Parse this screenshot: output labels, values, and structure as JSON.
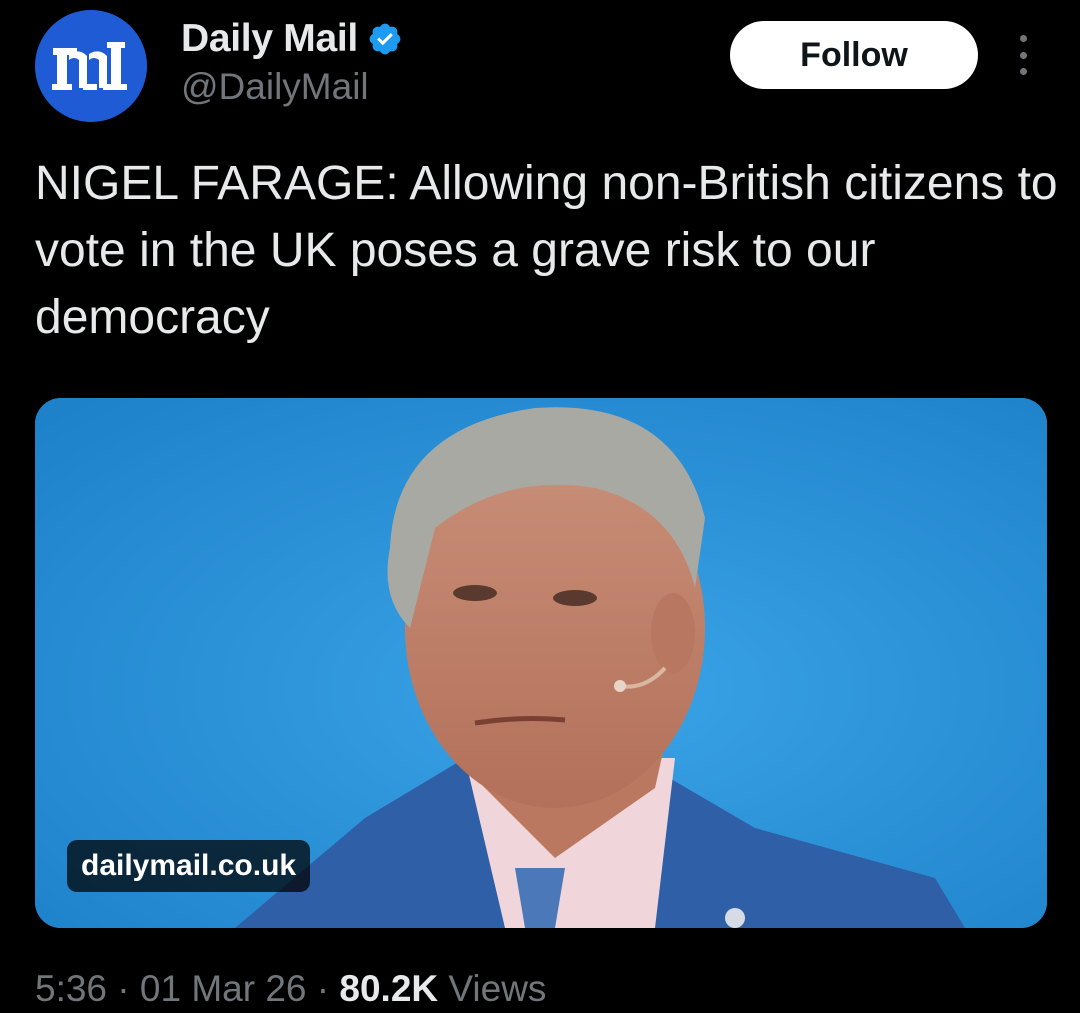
{
  "account": {
    "display_name": "Daily Mail",
    "handle": "@DailyMail",
    "verified": true,
    "avatar_icon": "daily-mail-logo-icon",
    "avatar_color": "#1f5bd4",
    "verified_color": "#1d9bf0"
  },
  "follow_button": {
    "label": "Follow"
  },
  "more_menu": {
    "icon": "vertical-ellipsis-icon"
  },
  "tweet": {
    "text": "NIGEL FARAGE: Allowing non-British citizens to vote in the UK poses a grave risk to our democracy"
  },
  "media": {
    "background_color": "#2a93d9",
    "link_domain": "dailymail.co.uk"
  },
  "meta": {
    "time": "5:36",
    "separator": " · ",
    "date": "01 Mar 26",
    "views_count": "80.2K",
    "views_label": " Views"
  }
}
